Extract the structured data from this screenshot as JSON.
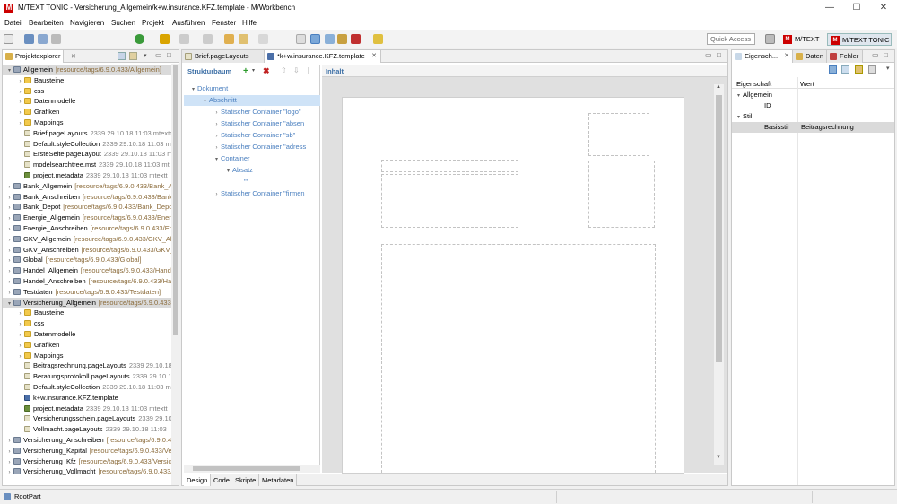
{
  "window": {
    "title": "M/TEXT TONIC - Versicherung_Allgemein/k+w.insurance.KFZ.template - M/Workbench",
    "logo": "M",
    "min": "—",
    "max": "☐",
    "close": "✕"
  },
  "menu": [
    "Datei",
    "Bearbeiten",
    "Navigieren",
    "Suchen",
    "Projekt",
    "Ausführen",
    "Fenster",
    "Hilfe"
  ],
  "toolbar": {
    "quick_access": "Quick Access",
    "perspectives": [
      "M/TEXT",
      "M/TEXT TONIC"
    ]
  },
  "project_explorer": {
    "tab_label": "Projektexplorer",
    "rows": [
      {
        "indent": 0,
        "tw": "▾",
        "icon": "proj",
        "name": "Allgemein",
        "extra": "[resource/tags/6.9.0.433/Allgemein]",
        "extra_class": "brown",
        "sel": true
      },
      {
        "indent": 1,
        "tw": "›",
        "icon": "fold",
        "name": "Bausteine",
        "extra": "",
        "extra_class": ""
      },
      {
        "indent": 1,
        "tw": "›",
        "icon": "fold",
        "name": "css",
        "extra": "",
        "extra_class": ""
      },
      {
        "indent": 1,
        "tw": "›",
        "icon": "fold",
        "name": "Datenmodelle",
        "extra": "",
        "extra_class": ""
      },
      {
        "indent": 1,
        "tw": "›",
        "icon": "fold",
        "name": "Grafiken",
        "extra": "",
        "extra_class": ""
      },
      {
        "indent": 1,
        "tw": "›",
        "icon": "fold",
        "name": "Mappings",
        "extra": "",
        "extra_class": ""
      },
      {
        "indent": 1,
        "tw": "",
        "icon": "file",
        "name": "Brief.pageLayouts",
        "extra": "2339  29.10.18 11:03  mtextc",
        "extra_class": "gray"
      },
      {
        "indent": 1,
        "tw": "",
        "icon": "file",
        "name": "Default.styleCollection",
        "extra": "2339  29.10.18 11:03  m",
        "extra_class": "gray"
      },
      {
        "indent": 1,
        "tw": "",
        "icon": "file",
        "name": "ErsteSeite.pageLayout",
        "extra": "2339  29.10.18 11:03  m",
        "extra_class": "gray"
      },
      {
        "indent": 1,
        "tw": "",
        "icon": "file",
        "name": "modelsearchtree.mst",
        "extra": "2339  29.10.18 11:03  mt",
        "extra_class": "gray"
      },
      {
        "indent": 1,
        "tw": "",
        "icon": "meta",
        "name": "project.metadata",
        "extra": "2339  29.10.18 11:03  mtextt",
        "extra_class": "gray"
      },
      {
        "indent": 0,
        "tw": "›",
        "icon": "proj",
        "name": "Bank_Allgemein",
        "extra": "[resource/tags/6.9.0.433/Bank_A",
        "extra_class": "brown"
      },
      {
        "indent": 0,
        "tw": "›",
        "icon": "proj",
        "name": "Bank_Anschreiben",
        "extra": "[resource/tags/6.9.0.433/Bank",
        "extra_class": "brown"
      },
      {
        "indent": 0,
        "tw": "›",
        "icon": "proj",
        "name": "Bank_Depot",
        "extra": "[resource/tags/6.9.0.433/Bank_Depo",
        "extra_class": "brown"
      },
      {
        "indent": 0,
        "tw": "›",
        "icon": "proj",
        "name": "Energie_Allgemein",
        "extra": "[resource/tags/6.9.0.433/Ener",
        "extra_class": "brown"
      },
      {
        "indent": 0,
        "tw": "›",
        "icon": "proj",
        "name": "Energie_Anschreiben",
        "extra": "[resource/tags/6.9.0.433/En",
        "extra_class": "brown"
      },
      {
        "indent": 0,
        "tw": "›",
        "icon": "proj",
        "name": "GKV_Allgemein",
        "extra": "[resource/tags/6.9.0.433/GKV_All",
        "extra_class": "brown"
      },
      {
        "indent": 0,
        "tw": "›",
        "icon": "proj",
        "name": "GKV_Anschreiben",
        "extra": "[resource/tags/6.9.0.433/GKV_",
        "extra_class": "brown"
      },
      {
        "indent": 0,
        "tw": "›",
        "icon": "proj",
        "name": "Global",
        "extra": "[resource/tags/6.9.0.433/Global]",
        "extra_class": "brown"
      },
      {
        "indent": 0,
        "tw": "›",
        "icon": "proj",
        "name": "Handel_Allgemein",
        "extra": "[resource/tags/6.9.0.433/Hand",
        "extra_class": "brown"
      },
      {
        "indent": 0,
        "tw": "›",
        "icon": "proj",
        "name": "Handel_Anschreiben",
        "extra": "[resource/tags/6.9.0.433/Ha",
        "extra_class": "brown"
      },
      {
        "indent": 0,
        "tw": "›",
        "icon": "proj",
        "name": "Testdaten",
        "extra": "[resource/tags/6.9.0.433/Testdaten]",
        "extra_class": "brown"
      },
      {
        "indent": 0,
        "tw": "▾",
        "icon": "proj",
        "name": "Versicherung_Allgemein",
        "extra": "[resource/tags/6.9.0.433",
        "extra_class": "brown",
        "sel": true
      },
      {
        "indent": 1,
        "tw": "›",
        "icon": "fold",
        "name": "Bausteine",
        "extra": "",
        "extra_class": ""
      },
      {
        "indent": 1,
        "tw": "›",
        "icon": "fold",
        "name": "css",
        "extra": "",
        "extra_class": ""
      },
      {
        "indent": 1,
        "tw": "›",
        "icon": "fold",
        "name": "Datenmodelle",
        "extra": "",
        "extra_class": ""
      },
      {
        "indent": 1,
        "tw": "›",
        "icon": "fold",
        "name": "Grafiken",
        "extra": "",
        "extra_class": ""
      },
      {
        "indent": 1,
        "tw": "›",
        "icon": "fold",
        "name": "Mappings",
        "extra": "",
        "extra_class": ""
      },
      {
        "indent": 1,
        "tw": "",
        "icon": "file",
        "name": "Beitragsrechnung.pageLayouts",
        "extra": "2339  29.10.18",
        "extra_class": "gray"
      },
      {
        "indent": 1,
        "tw": "",
        "icon": "file",
        "name": "Beratungsprotokoll.pageLayouts",
        "extra": "2339  29.10.1",
        "extra_class": "gray"
      },
      {
        "indent": 1,
        "tw": "",
        "icon": "file",
        "name": "Default.styleCollection",
        "extra": "2339  29.10.18 11:03  m",
        "extra_class": "gray"
      },
      {
        "indent": 1,
        "tw": "",
        "icon": "tpl",
        "name": "k+w.insurance.KFZ.template",
        "extra": "",
        "extra_class": ""
      },
      {
        "indent": 1,
        "tw": "",
        "icon": "meta",
        "name": "project.metadata",
        "extra": "2339  29.10.18 11:03  mtextt",
        "extra_class": "gray"
      },
      {
        "indent": 1,
        "tw": "",
        "icon": "file",
        "name": "Versicherungsschein.pageLayouts",
        "extra": "2339  29.10.",
        "extra_class": "gray"
      },
      {
        "indent": 1,
        "tw": "",
        "icon": "file",
        "name": "Vollmacht.pageLayouts",
        "extra": "2339  29.10.18 11:03",
        "extra_class": "gray"
      },
      {
        "indent": 0,
        "tw": "›",
        "icon": "proj",
        "name": "Versicherung_Anschreiben",
        "extra": "[resource/tags/6.9.0.433",
        "extra_class": "brown"
      },
      {
        "indent": 0,
        "tw": "›",
        "icon": "proj",
        "name": "Versicherung_Kapital",
        "extra": "[resource/tags/6.9.0.433/Ve",
        "extra_class": "brown"
      },
      {
        "indent": 0,
        "tw": "›",
        "icon": "proj",
        "name": "Versicherung_Kfz",
        "extra": "[resource/tags/6.9.0.433/Versich",
        "extra_class": "brown"
      },
      {
        "indent": 0,
        "tw": "›",
        "icon": "proj",
        "name": "Versicherung_Vollmacht",
        "extra": "[resource/tags/6.9.0.433/",
        "extra_class": "brown"
      }
    ]
  },
  "editor": {
    "tabs": [
      "Brief.pageLayouts",
      "*k+w.insurance.KFZ.template"
    ],
    "structure_label": "Strukturbaum",
    "content_label": "Inhalt",
    "tree": [
      {
        "indent": 0,
        "tw": "▾",
        "label": "Dokument",
        "sel": false
      },
      {
        "indent": 1,
        "tw": "▾",
        "label": "Abschnitt",
        "sel": true
      },
      {
        "indent": 2,
        "tw": "›",
        "label": "Statischer Container \"logo\"",
        "sel": false
      },
      {
        "indent": 2,
        "tw": "›",
        "label": "Statischer Container \"absen",
        "sel": false
      },
      {
        "indent": 2,
        "tw": "›",
        "label": "Statischer Container \"sb\"",
        "sel": false
      },
      {
        "indent": 2,
        "tw": "›",
        "label": "Statischer Container \"adress",
        "sel": false
      },
      {
        "indent": 2,
        "tw": "▾",
        "label": "Container",
        "sel": false
      },
      {
        "indent": 3,
        "tw": "▾",
        "label": "Absatz",
        "sel": false
      },
      {
        "indent": 4,
        "tw": "",
        "label": "\"\"",
        "sel": false
      },
      {
        "indent": 2,
        "tw": "›",
        "label": "Statischer Container \"firmen",
        "sel": false
      }
    ],
    "bottom_tabs": [
      "Design",
      "Code",
      "Skripte",
      "Metadaten"
    ]
  },
  "properties": {
    "tabs": [
      "Eigensch...",
      "Daten",
      "Fehler"
    ],
    "col_property": "Eigenschaft",
    "col_value": "Wert",
    "rows": [
      {
        "indent": 0,
        "tw": "▾",
        "name": "Allgemein",
        "value": ""
      },
      {
        "indent": 1,
        "tw": "",
        "name": "ID",
        "value": ""
      },
      {
        "indent": 0,
        "tw": "▾",
        "name": "Stil",
        "value": ""
      },
      {
        "indent": 1,
        "tw": "",
        "name": "Basisstil",
        "value": "Beitragsrechnung",
        "sel": true
      }
    ]
  },
  "status": {
    "text": "RootPart"
  }
}
